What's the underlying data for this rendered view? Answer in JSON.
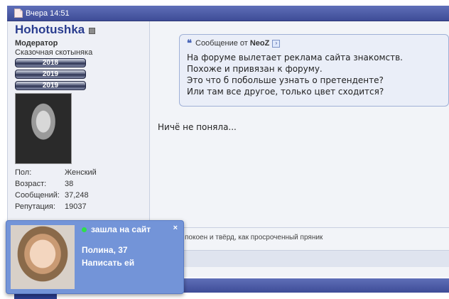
{
  "post": {
    "date": "Вчера 14:51"
  },
  "user": {
    "name": "Hohotushka",
    "title": "Модератор",
    "subtitle": "Сказочная скотыняка",
    "awards": [
      "2018",
      "2019",
      "2019"
    ],
    "profile": [
      {
        "key": "Пол:",
        "value": "Женский"
      },
      {
        "key": "Возраст:",
        "value": "38"
      },
      {
        "key": "Сообщений:",
        "value": "37,248"
      },
      {
        "key": "Репутация:",
        "value": "19037"
      }
    ]
  },
  "quote": {
    "label": "Сообщение от",
    "author": "NeoZ",
    "text": "На форуме вылетает реклама сайта знакомств.\nПохоже и привязан к форуму.\nЭто что б побольше узнать о претенденте?\nИли там все другое, только цвет сходится?"
  },
  "reply_text": "Ничё не поняла...",
  "signature": "покоен и твёрд, как просроченный пряник",
  "popup": {
    "status": "зашла на сайт",
    "close": "×",
    "name": "Полина, 37",
    "action": "Написать ей",
    "online_color": "#2ee04a"
  }
}
